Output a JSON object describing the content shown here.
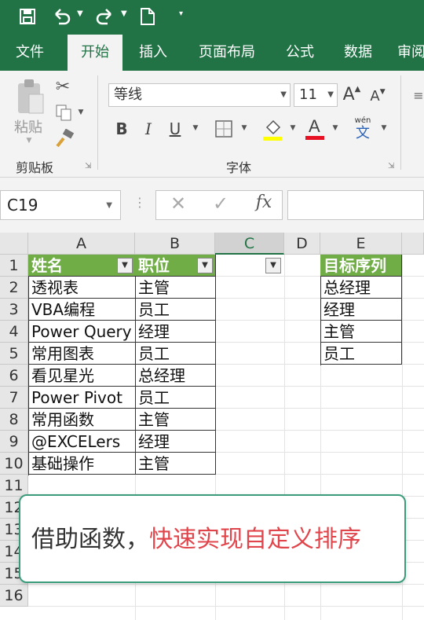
{
  "toolbar": {
    "save_icon": "save-icon",
    "undo_icon": "undo-icon",
    "redo_icon": "redo-icon",
    "new_icon": "new-file-icon",
    "customize_icon": "customize-qat-icon"
  },
  "tabs": [
    {
      "label": "文件"
    },
    {
      "label": "开始",
      "active": true
    },
    {
      "label": "插入"
    },
    {
      "label": "页面布局"
    },
    {
      "label": "公式"
    },
    {
      "label": "数据"
    },
    {
      "label": "审阅"
    }
  ],
  "ribbon": {
    "paste_label": "粘贴",
    "clipboard_group": "剪贴板",
    "font_group": "字体",
    "font_name": "等线",
    "font_size": "11",
    "phonetic_label": "wén",
    "phonetic_char": "文",
    "colors": {
      "highlight": "#ffff00",
      "font_color": "#e81123",
      "accent": "#217346"
    }
  },
  "formula_bar": {
    "name_box": "C19",
    "fx": "fx",
    "formula": ""
  },
  "grid": {
    "columns": [
      "A",
      "B",
      "C",
      "D",
      "E"
    ],
    "selected_column": "C",
    "rows": [
      "1",
      "2",
      "3",
      "4",
      "5",
      "6",
      "7",
      "8",
      "9",
      "10",
      "11",
      "12",
      "13",
      "14",
      "15",
      "16"
    ],
    "table": {
      "headers": [
        "姓名",
        "职位"
      ],
      "rows": [
        [
          "透视表",
          "主管"
        ],
        [
          "VBA编程",
          "员工"
        ],
        [
          "Power Query",
          "经理"
        ],
        [
          "常用图表",
          "员工"
        ],
        [
          "看见星光",
          "总经理"
        ],
        [
          "Power Pivot",
          "员工"
        ],
        [
          "常用函数",
          "主管"
        ],
        [
          "@EXCELers",
          "经理"
        ],
        [
          "基础操作",
          "主管"
        ]
      ]
    },
    "target": {
      "header": "目标序列",
      "items": [
        "总经理",
        "经理",
        "主管",
        "员工"
      ]
    }
  },
  "callout": {
    "part1": "借助函数，",
    "part2": "快速实现自定义排序"
  }
}
